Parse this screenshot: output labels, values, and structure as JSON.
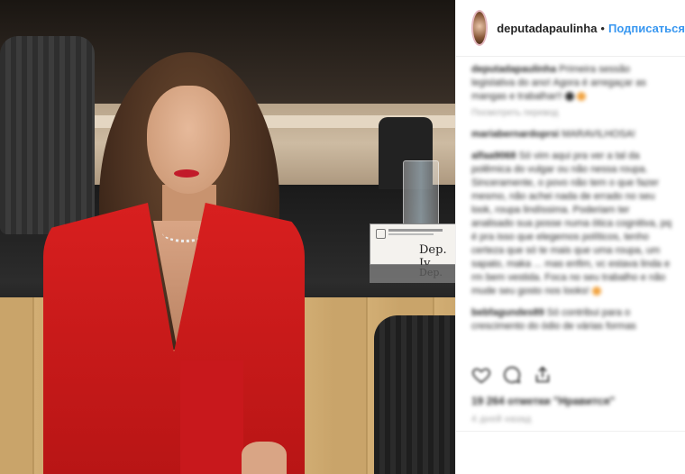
{
  "post": {
    "username": "deputadapaulinha",
    "follow_label": "Подписаться",
    "nameplate_text": "Dep. Iv",
    "nameplate_reflection": "Dep."
  },
  "comments": [
    {
      "user": "deputadapaulinha",
      "text": "Primeira sessão legislativa do ano! Agora é arregaçar as mangas e trabalhar!!",
      "meta": "Посмотреть перевод"
    },
    {
      "user": "mariabernardoprsi",
      "text": "MARAVILHOSA!",
      "meta": ""
    },
    {
      "user": "alfaa9068",
      "text": "Só vim aqui pra ver a tal da polêmica do vulgar ou não nessa roupa. Sinceramente, o povo não tem o que fazer mesmo, não achei nada de errado no seu look, roupa lindíssima. Poderiam ter analisado sua posse numa ótica cognitiva, pq é pra isso que elegemos políticos, tenho certeza que só te mais que uma roupa, um sapato, maka ... mas enfim, vc estava linda e rm bem vestida. Foca no seu trabalho e não mude seu gosto nos looks!",
      "meta": ""
    },
    {
      "user": "bebfagundes89",
      "text": "Só contribui para o crescimento do ódio de várias formas",
      "meta": ""
    }
  ],
  "actions": {
    "like_icon": "heart-icon",
    "comment_icon": "comment-icon",
    "share_icon": "share-icon"
  },
  "likes_text": "19 264 отметки \"Нравится\"",
  "date_text": "4 дней назад"
}
